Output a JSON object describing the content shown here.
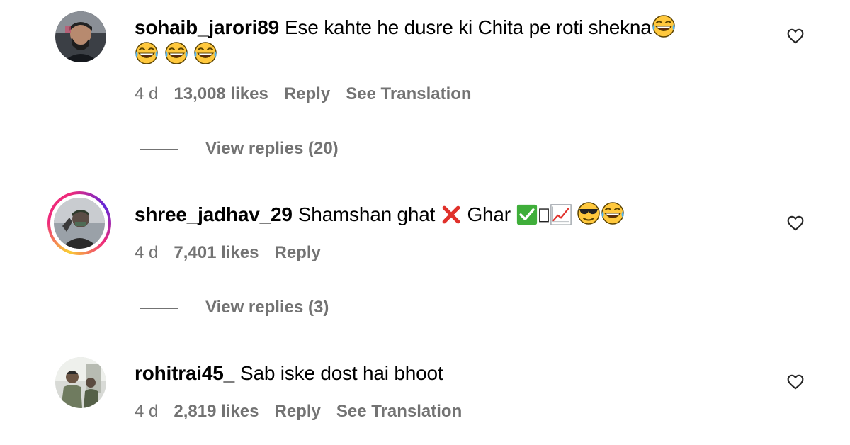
{
  "comments": [
    {
      "username": "sohaib_jarori89",
      "text": "Ese kahte he dusre ki Chita pe roti shekna",
      "emojis_inline": [
        "tears-of-joy"
      ],
      "emojis_line2": [
        "tears-of-joy",
        "tears-of-joy",
        "tears-of-joy"
      ],
      "time": "4 d",
      "likes": "13,008 likes",
      "reply": "Reply",
      "translation": "See Translation",
      "view_replies": "View replies (20)",
      "has_story_ring": false
    },
    {
      "username": "shree_jadhav_29",
      "text": "Shamshan ghat",
      "text2": "Ghar",
      "emojis": [
        "cross-mark",
        "check-mark",
        "empty-box",
        "chart-increasing",
        "sunglasses-face",
        "tears-of-joy"
      ],
      "time": "4 d",
      "likes": "7,401 likes",
      "reply": "Reply",
      "view_replies": "View replies (3)",
      "has_story_ring": true
    },
    {
      "username": "rohitrai45_",
      "text": "Sab iske dost hai bhoot",
      "time": "4 d",
      "likes": "2,819 likes",
      "reply": "Reply",
      "translation": "See Translation",
      "has_story_ring": false
    }
  ],
  "colors": {
    "meta_gray": "#737373",
    "text": "#000000",
    "story_ring": [
      "#f9ce34",
      "#ee2a7b",
      "#6228d7"
    ]
  },
  "icons": {
    "like": "heart-outline-icon"
  }
}
